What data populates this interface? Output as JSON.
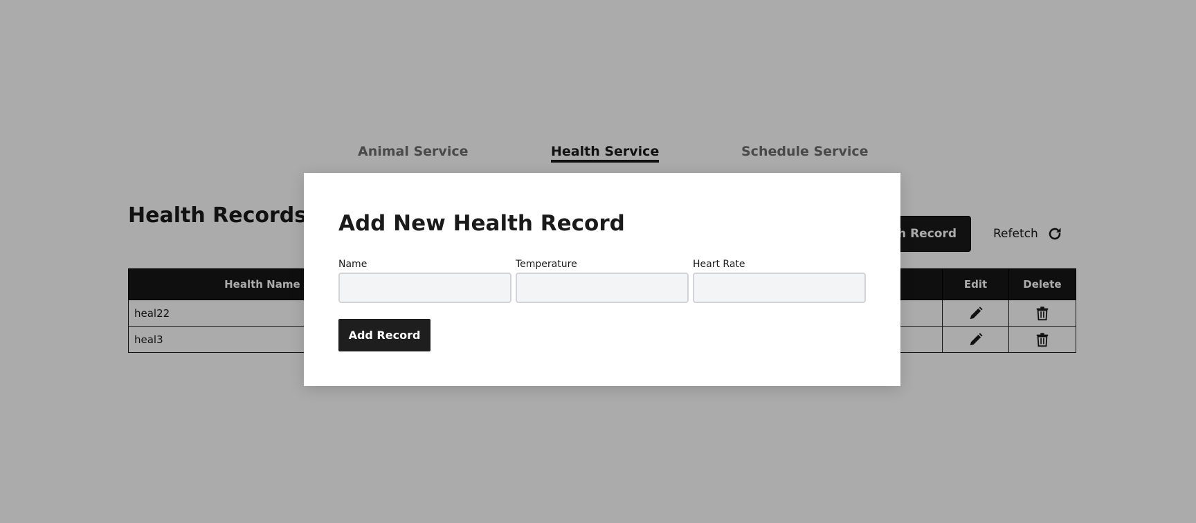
{
  "nav": {
    "items": [
      {
        "label": "Animal Service",
        "active": false
      },
      {
        "label": "Health Service",
        "active": true
      },
      {
        "label": "Schedule Service",
        "active": false
      }
    ]
  },
  "page": {
    "title": "Health Records",
    "add_button_label": "Add Health Record",
    "refetch_label": "Refetch"
  },
  "table": {
    "headers": {
      "name": "Health Name",
      "edit": "Edit",
      "delete": "Delete"
    },
    "rows": [
      {
        "name": "heal22"
      },
      {
        "name": "heal3"
      }
    ]
  },
  "modal": {
    "title": "Add New Health Record",
    "fields": [
      {
        "label": "Name",
        "value": "",
        "placeholder": ""
      },
      {
        "label": "Temperature",
        "value": "",
        "placeholder": ""
      },
      {
        "label": "Heart Rate",
        "value": "",
        "placeholder": ""
      }
    ],
    "submit_label": "Add Record"
  },
  "colors": {
    "dark": "#1a1a1a",
    "table_header_bg": "#171717",
    "input_bg": "#f3f4f6",
    "input_border": "#d1d3d8",
    "nav_inactive": "#6e6e6e",
    "overlay": "rgba(0,0,0,0.33)"
  },
  "icons": {
    "edit": "pencil-icon",
    "delete": "trash-icon",
    "refetch": "refresh-icon"
  }
}
